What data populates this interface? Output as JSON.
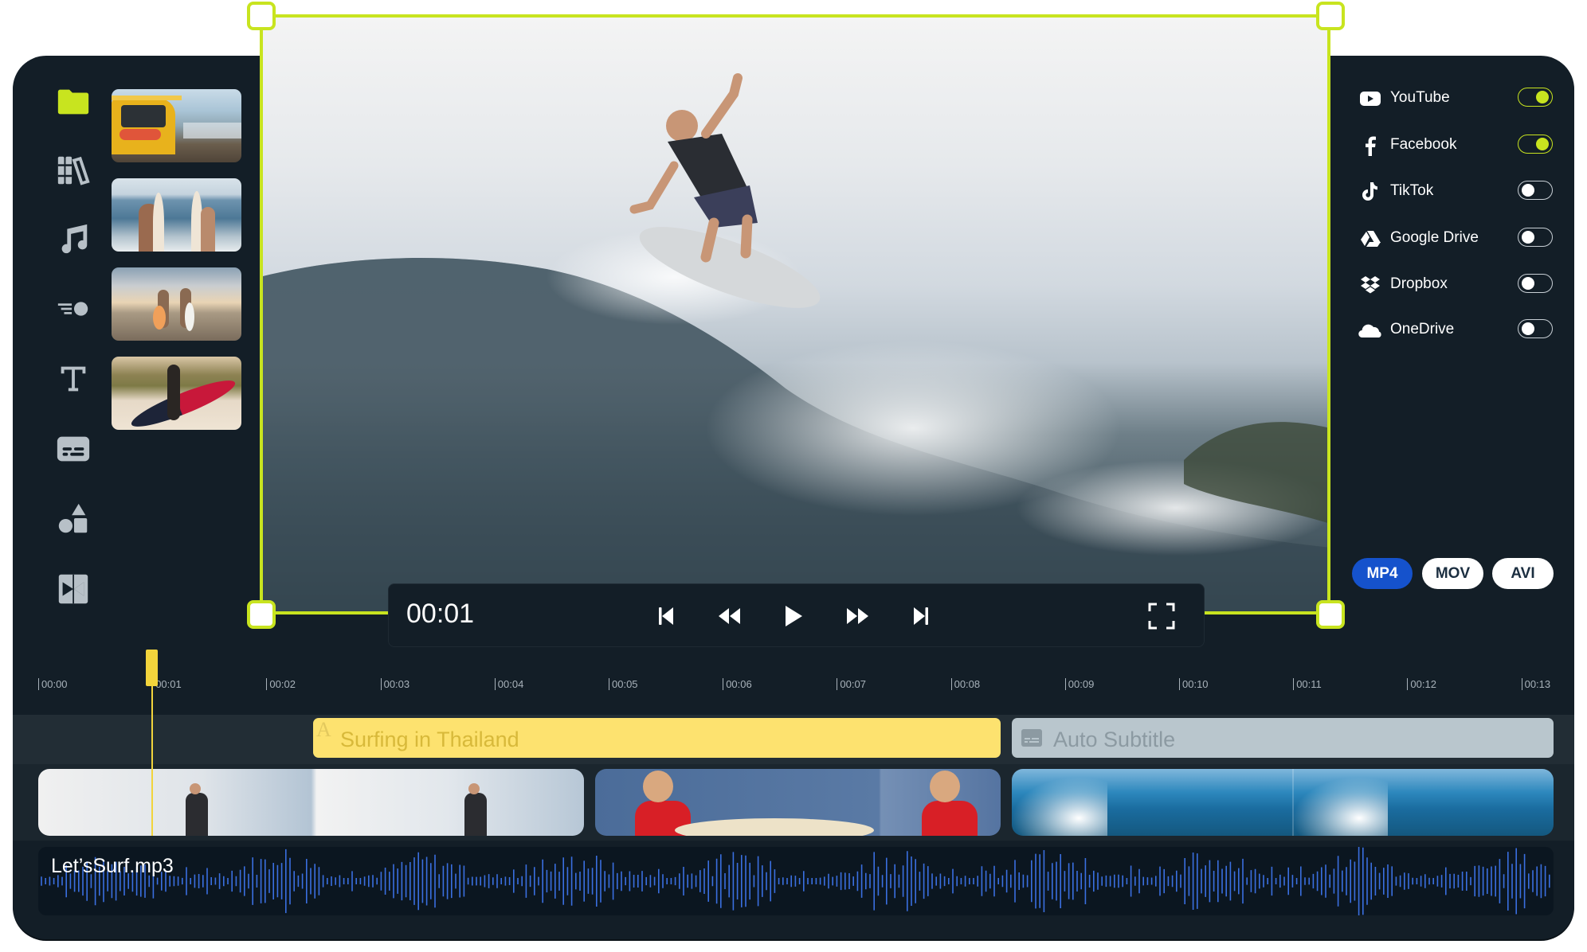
{
  "colors": {
    "accent": "#c8e41f",
    "panel_bg": "#131e27",
    "playhead": "#f2d43c",
    "text_clip": "#fde26f",
    "subtitle_clip": "#b9c6cd",
    "format_active": "#1552cc",
    "waveform": "#3a6fe0"
  },
  "sidebar": {
    "items": [
      {
        "name": "media-folder",
        "icon": "folder-icon",
        "active": true
      },
      {
        "name": "library",
        "icon": "library-icon",
        "active": false
      },
      {
        "name": "audio",
        "icon": "music-note-icon",
        "active": false
      },
      {
        "name": "effects",
        "icon": "motion-icon",
        "active": false
      },
      {
        "name": "text",
        "icon": "text-icon",
        "active": false
      },
      {
        "name": "subtitles",
        "icon": "subtitle-icon",
        "active": false
      },
      {
        "name": "elements",
        "icon": "shapes-icon",
        "active": false
      },
      {
        "name": "transitions",
        "icon": "transition-icon",
        "active": false
      }
    ]
  },
  "media": {
    "thumbnails": [
      {
        "name": "jeep-on-pier"
      },
      {
        "name": "couple-with-surfboards"
      },
      {
        "name": "women-walking-beach"
      },
      {
        "name": "girl-with-red-surfboard"
      }
    ]
  },
  "player": {
    "current_time": "00:01",
    "controls": [
      "skip-back",
      "rewind",
      "play",
      "fast-forward",
      "skip-forward",
      "fullscreen"
    ]
  },
  "share": {
    "destinations": [
      {
        "label": "YouTube",
        "icon": "youtube-icon",
        "enabled": true
      },
      {
        "label": "Facebook",
        "icon": "facebook-icon",
        "enabled": true
      },
      {
        "label": "TikTok",
        "icon": "tiktok-icon",
        "enabled": false
      },
      {
        "label": "Google Drive",
        "icon": "google-drive-icon",
        "enabled": false
      },
      {
        "label": "Dropbox",
        "icon": "dropbox-icon",
        "enabled": false
      },
      {
        "label": "OneDrive",
        "icon": "onedrive-icon",
        "enabled": false
      }
    ],
    "formats": [
      {
        "label": "MP4",
        "selected": true
      },
      {
        "label": "MOV",
        "selected": false
      },
      {
        "label": "AVI",
        "selected": false
      }
    ]
  },
  "timeline": {
    "ticks": [
      "00:00",
      "00:01",
      "00:02",
      "00:03",
      "00:04",
      "00:05",
      "00:06",
      "00:07",
      "00:08",
      "00:09",
      "00:10",
      "00:11",
      "00:12",
      "00:13"
    ],
    "playhead_seconds": 1.0,
    "text_track": {
      "title_clip": {
        "label": "Surfing in Thailand",
        "icon_glyph": "A"
      },
      "subtitle_clip": {
        "label": "Auto Subtitle"
      }
    },
    "video_track": [
      {
        "name": "surfer-jump-clip"
      },
      {
        "name": "surfer-red-shirt-clip"
      },
      {
        "name": "wave-barrel-clip"
      }
    ],
    "audio_track": {
      "label": "Let’sSurf.mp3"
    }
  }
}
